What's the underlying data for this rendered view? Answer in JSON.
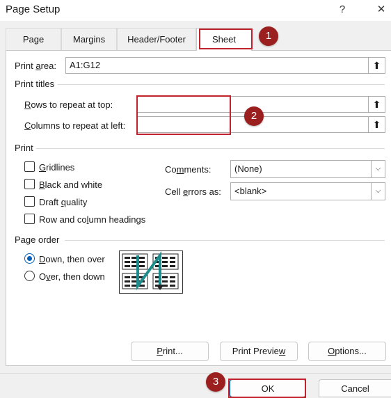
{
  "window": {
    "title": "Page Setup",
    "help_glyph": "?",
    "close_glyph": "✕"
  },
  "tabs": [
    {
      "label": "Page"
    },
    {
      "label": "Margins"
    },
    {
      "label": "Header/Footer"
    },
    {
      "label": "Sheet"
    }
  ],
  "print_area": {
    "label_pre": "Print ",
    "label_u": "a",
    "label_post": "rea:",
    "value": "A1:G12"
  },
  "print_titles": {
    "heading": "Print titles",
    "rows": {
      "label_u": "R",
      "label_post": "ows to repeat at top:",
      "value": ""
    },
    "cols": {
      "label_u": "C",
      "label_post": "olumns to repeat at left:",
      "value": ""
    }
  },
  "print": {
    "heading": "Print",
    "checkboxes": [
      {
        "u": "G",
        "rest": "ridlines",
        "checked": false
      },
      {
        "u": "B",
        "rest": "lack and white",
        "checked": false
      },
      {
        "pre": "Draft ",
        "u": "q",
        "rest": "uality",
        "checked": false
      },
      {
        "pre": "Row and co",
        "u": "l",
        "rest": "umn headings",
        "checked": false
      }
    ],
    "comments": {
      "pre": "Co",
      "u": "m",
      "post": "ments:",
      "value": "(None)"
    },
    "cell_errors": {
      "pre": "Cell ",
      "u": "e",
      "post": "rrors as:",
      "value": "<blank>"
    }
  },
  "page_order": {
    "heading": "Page order",
    "down": {
      "u": "D",
      "rest": "own, then over",
      "selected": true
    },
    "over": {
      "pre": "O",
      "u": "v",
      "rest": "er, then down",
      "selected": false
    }
  },
  "buttons": {
    "print": {
      "u": "P",
      "rest": "rint..."
    },
    "preview": {
      "pre": "Print Previe",
      "u": "w",
      "rest": ""
    },
    "options": {
      "u": "O",
      "rest": "ptions..."
    },
    "ok": "OK",
    "cancel": "Cancel"
  },
  "annotations": {
    "one": "1",
    "two": "2",
    "three": "3"
  },
  "colors": {
    "accent": "#005fb8",
    "annotation_red": "#c0232b",
    "badge": "#9c1f1f",
    "arrow": "#1e8c8c"
  }
}
